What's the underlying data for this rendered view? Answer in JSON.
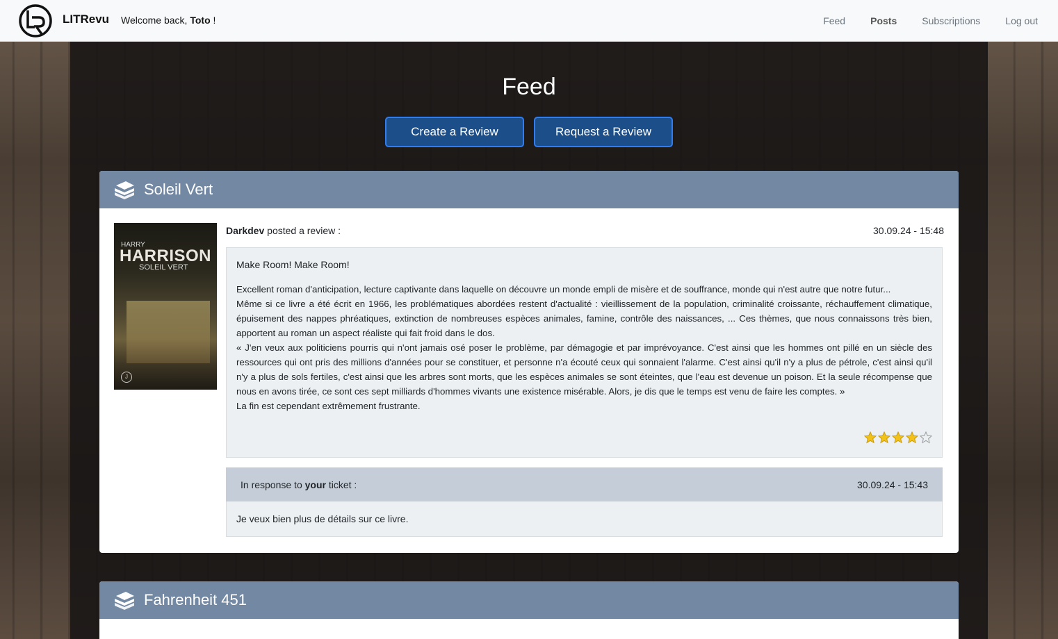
{
  "nav": {
    "brand": "LITRevu",
    "welcome_prefix": "Welcome back, ",
    "username": "Toto",
    "welcome_suffix": " !",
    "links": [
      "Feed",
      "Posts",
      "Subscriptions",
      "Log out"
    ],
    "active_link": "Posts"
  },
  "page": {
    "title": "Feed",
    "create_review_label": "Create a Review",
    "request_review_label": "Request a Review"
  },
  "posts": [
    {
      "book_title": "Soleil Vert",
      "cover": {
        "author_first": "HARRY",
        "author_last": "HARRISON",
        "title": "SOLEIL VERT",
        "publisher_mark": "J'ai lu"
      },
      "author": "Darkdev",
      "action": " posted a review :",
      "date": "30.09.24 - 15:48",
      "headline": "Make Room! Make Room!",
      "body": "Excellent roman d'anticipation, lecture captivante dans laquelle on découvre un monde empli de misère et de souffrance, monde qui n'est autre que notre futur...\nMême si ce livre a été écrit en 1966, les problématiques abordées restent d'actualité : vieillissement de la population, criminalité croissante, réchauffement climatique, épuisement des nappes phréatiques, extinction de nombreuses espèces animales, famine, contrôle des naissances, ... Ces thèmes, que nous connaissons très bien, apportent au roman un aspect réaliste qui fait froid dans le dos.\n« J'en veux aux politiciens pourris qui n'ont jamais osé poser le problème, par démagogie et par imprévoyance. C'est ainsi que les hommes ont pillé en un siècle des ressources qui ont pris des millions d'années pour se constituer, et personne n'a écouté ceux qui sonnaient l'alarme. C'est ainsi qu'il n'y a plus de pétrole, c'est ainsi qu'il n'y a plus de sols fertiles, c'est ainsi que les arbres sont morts, que les espèces animales se sont éteintes, que l'eau est devenue un poison. Et la seule récompense que nous en avons tirée, ce sont ces sept milliards d'hommes vivants une existence misérable. Alors, je dis que le temps est venu de faire les comptes. »\nLa fin est cependant extrêmement frustrante.",
      "rating": 4,
      "rating_max": 5,
      "response": {
        "prefix": "In response to ",
        "owner": "your",
        "suffix": " ticket :",
        "date": "30.09.24 - 15:43",
        "text": "Je veux bien plus de détails sur ce livre."
      }
    },
    {
      "book_title": "Fahrenheit 451"
    }
  ],
  "colors": {
    "card_header": "#7389a3",
    "button_bg": "#1c4e8a",
    "button_border": "#2f7df0",
    "star": "#f2c21b"
  }
}
